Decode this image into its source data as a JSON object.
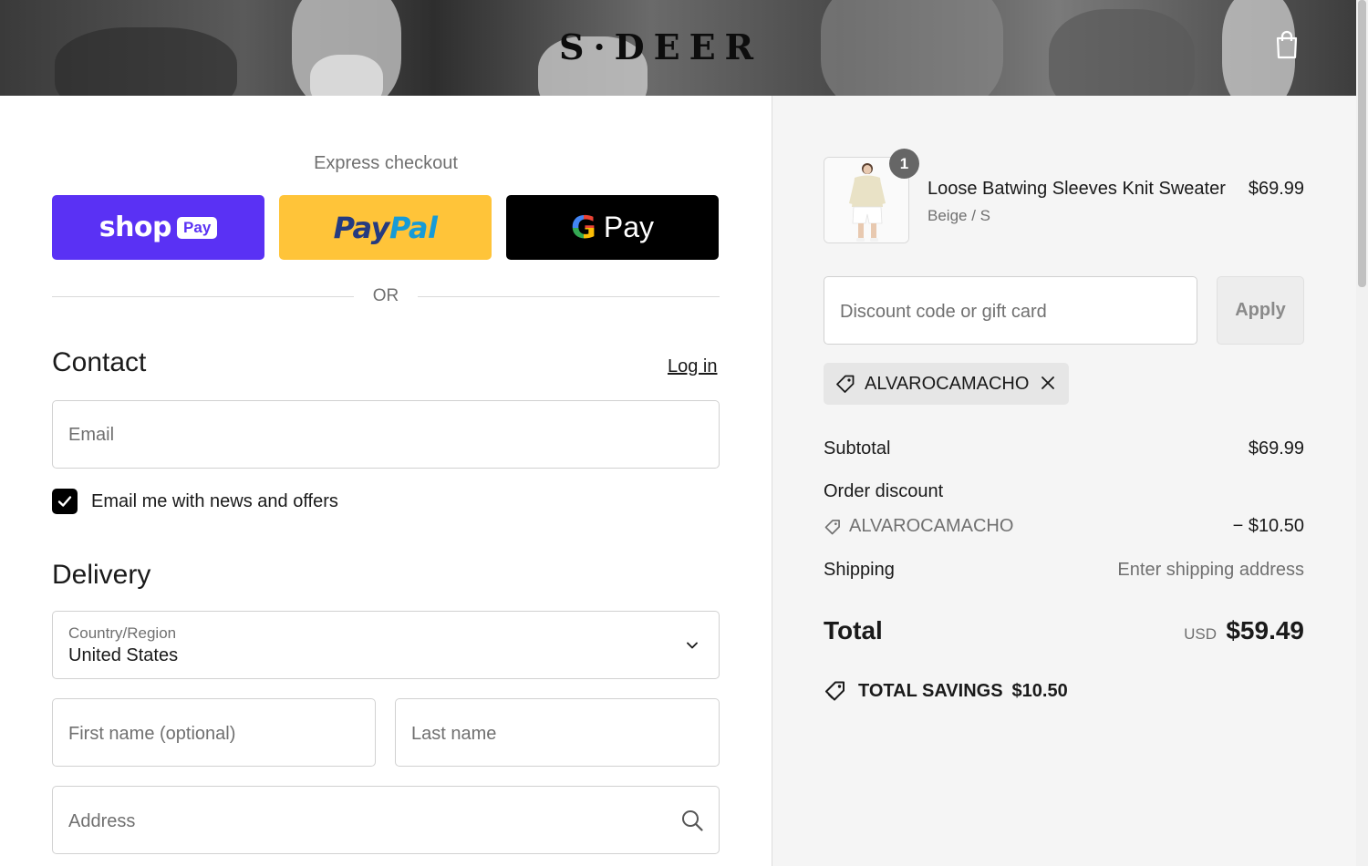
{
  "header": {
    "brand": "S·DEER",
    "cart_icon": "shopping-bag-icon"
  },
  "express": {
    "label": "Express checkout",
    "shop_pay": {
      "word": "shop",
      "pill": "Pay"
    },
    "paypal": {
      "part1": "Pay",
      "part2": "Pal"
    },
    "google_pay": {
      "g": "G",
      "word": "Pay"
    },
    "or": "OR"
  },
  "contact": {
    "title": "Contact",
    "login": "Log in",
    "email_placeholder": "Email",
    "newsletter_label": "Email me with news and offers",
    "newsletter_checked": true
  },
  "delivery": {
    "title": "Delivery",
    "country_label": "Country/Region",
    "country_value": "United States",
    "first_name_placeholder": "First name (optional)",
    "last_name_placeholder": "Last name",
    "address_placeholder": "Address"
  },
  "summary": {
    "item": {
      "quantity": "1",
      "name": "Loose Batwing Sleeves Knit Sweater",
      "variant": "Beige / S",
      "price": "$69.99"
    },
    "discount_placeholder": "Discount code or gift card",
    "apply_label": "Apply",
    "applied_code": "ALVAROCAMACHO",
    "subtotal_label": "Subtotal",
    "subtotal_value": "$69.99",
    "order_discount_label": "Order discount",
    "order_discount_code": "ALVAROCAMACHO",
    "order_discount_value": "− $10.50",
    "shipping_label": "Shipping",
    "shipping_value": "Enter shipping address",
    "total_label": "Total",
    "total_currency": "USD",
    "total_value": "$59.49",
    "savings_label": "TOTAL SAVINGS",
    "savings_value": "$10.50"
  },
  "colors": {
    "shop_pay": "#5a31f4",
    "paypal": "#ffc439",
    "google_pay": "#000000",
    "summary_bg": "#f5f5f5"
  }
}
